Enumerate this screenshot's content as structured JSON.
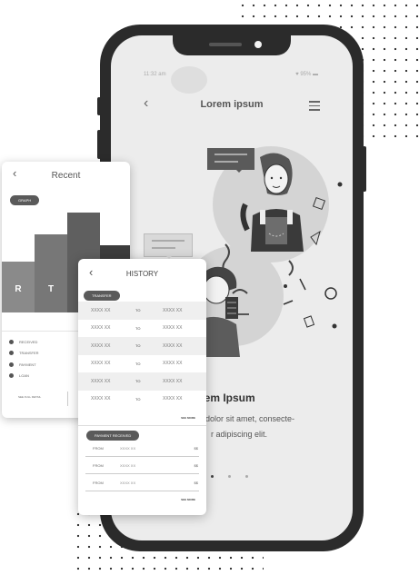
{
  "phone": {
    "status_time": "11:32 am",
    "status_right": "♥ 95% ▬",
    "back_icon": "chevron-left-icon",
    "title": "Lorem ipsum",
    "menu_icon": "hamburger-icon",
    "heading": "rem Ipsum",
    "body_line1": "dolor sit amet, consecte-",
    "body_line2": "r adipiscing elit."
  },
  "recent": {
    "back_icon": "chevron-left-icon",
    "title": "Recent",
    "chip": "GRAPH",
    "bar_labels": [
      "R",
      "T"
    ],
    "legend": [
      "RECEIVED",
      "TRANSFER",
      "PAYMENT",
      "LOAN"
    ],
    "footer": "SEE FULL DETAIL"
  },
  "history": {
    "back_icon": "chevron-left-icon",
    "title": "HISTORY",
    "transfer_chip": "TRANSFER",
    "transfers": [
      {
        "from": "XXXX XX",
        "sep": "TO",
        "to": "XXXX XX"
      },
      {
        "from": "XXXX XX",
        "sep": "TO",
        "to": "XXXX XX"
      },
      {
        "from": "XXXX XX",
        "sep": "TO",
        "to": "XXXX XX"
      },
      {
        "from": "XXXX XX",
        "sep": "TO",
        "to": "XXXX XX"
      },
      {
        "from": "XXXX XX",
        "sep": "TO",
        "to": "XXXX XX"
      },
      {
        "from": "XXXX XX",
        "sep": "TO",
        "to": "XXXX XX"
      }
    ],
    "see_more": "SEE MORE",
    "payment_chip": "PAYMENT RECEIVED",
    "payments": [
      {
        "label": "FROM",
        "name": "XXXX XX",
        "amount": "$$"
      },
      {
        "label": "FROM",
        "name": "XXXX XX",
        "amount": "$$"
      },
      {
        "label": "FROM",
        "name": "XXXX XX",
        "amount": "$$"
      }
    ],
    "see_more_2": "SEE MORE"
  },
  "colors": {
    "phone_body": "#2b2b2b",
    "screen_bg": "#ececec",
    "chip": "#5a5a5a",
    "bar_dark": "#666666",
    "bar_light": "#8a8a8a"
  }
}
